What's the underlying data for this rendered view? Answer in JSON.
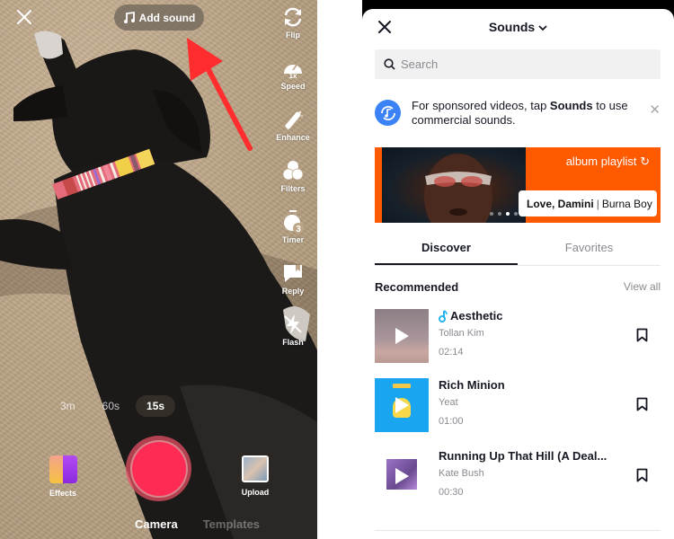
{
  "camera": {
    "close_icon": "close-icon",
    "add_sound_label": "Add sound",
    "tools": [
      {
        "label": "Flip",
        "icon": "flip-icon"
      },
      {
        "label": "Speed",
        "icon": "speed-icon",
        "badge": "1x"
      },
      {
        "label": "Enhance",
        "icon": "enhance-icon"
      },
      {
        "label": "Filters",
        "icon": "filters-icon"
      },
      {
        "label": "Timer",
        "icon": "timer-icon",
        "badge": "3"
      },
      {
        "label": "Reply",
        "icon": "reply-icon"
      },
      {
        "label": "Flash",
        "icon": "flash-off-icon"
      }
    ],
    "durations": [
      {
        "label": "3m",
        "active": false
      },
      {
        "label": "60s",
        "active": false
      },
      {
        "label": "15s",
        "active": true
      }
    ],
    "effects_label": "Effects",
    "upload_label": "Upload",
    "modes": [
      {
        "label": "Camera",
        "active": true
      },
      {
        "label": "Templates",
        "active": false
      }
    ],
    "annotation_arrow_color": "#ff2d2d"
  },
  "sounds": {
    "title": "Sounds",
    "search_placeholder": "Search",
    "notice": {
      "text_before": "For sponsored videos, tap ",
      "text_bold": "Sounds",
      "text_after": " to use commercial sounds."
    },
    "banner": {
      "brand": "album playlist",
      "album": "Love, Damini",
      "artist": "Burna Boy",
      "page_count": 4,
      "current_page": 3,
      "color": "#ff5a00"
    },
    "tabs": [
      {
        "label": "Discover",
        "active": true
      },
      {
        "label": "Favorites",
        "active": false
      }
    ],
    "section_title": "Recommended",
    "view_all_label": "View all",
    "tracks": [
      {
        "title": "Aesthetic",
        "artist": "Tollan Kim",
        "duration": "02:14",
        "original_sound": true
      },
      {
        "title": "Rich Minion",
        "artist": "Yeat",
        "duration": "01:00",
        "original_sound": false
      },
      {
        "title": "Running Up That Hill (A Deal...",
        "artist": "Kate Bush",
        "duration": "00:30",
        "original_sound": false
      }
    ]
  }
}
